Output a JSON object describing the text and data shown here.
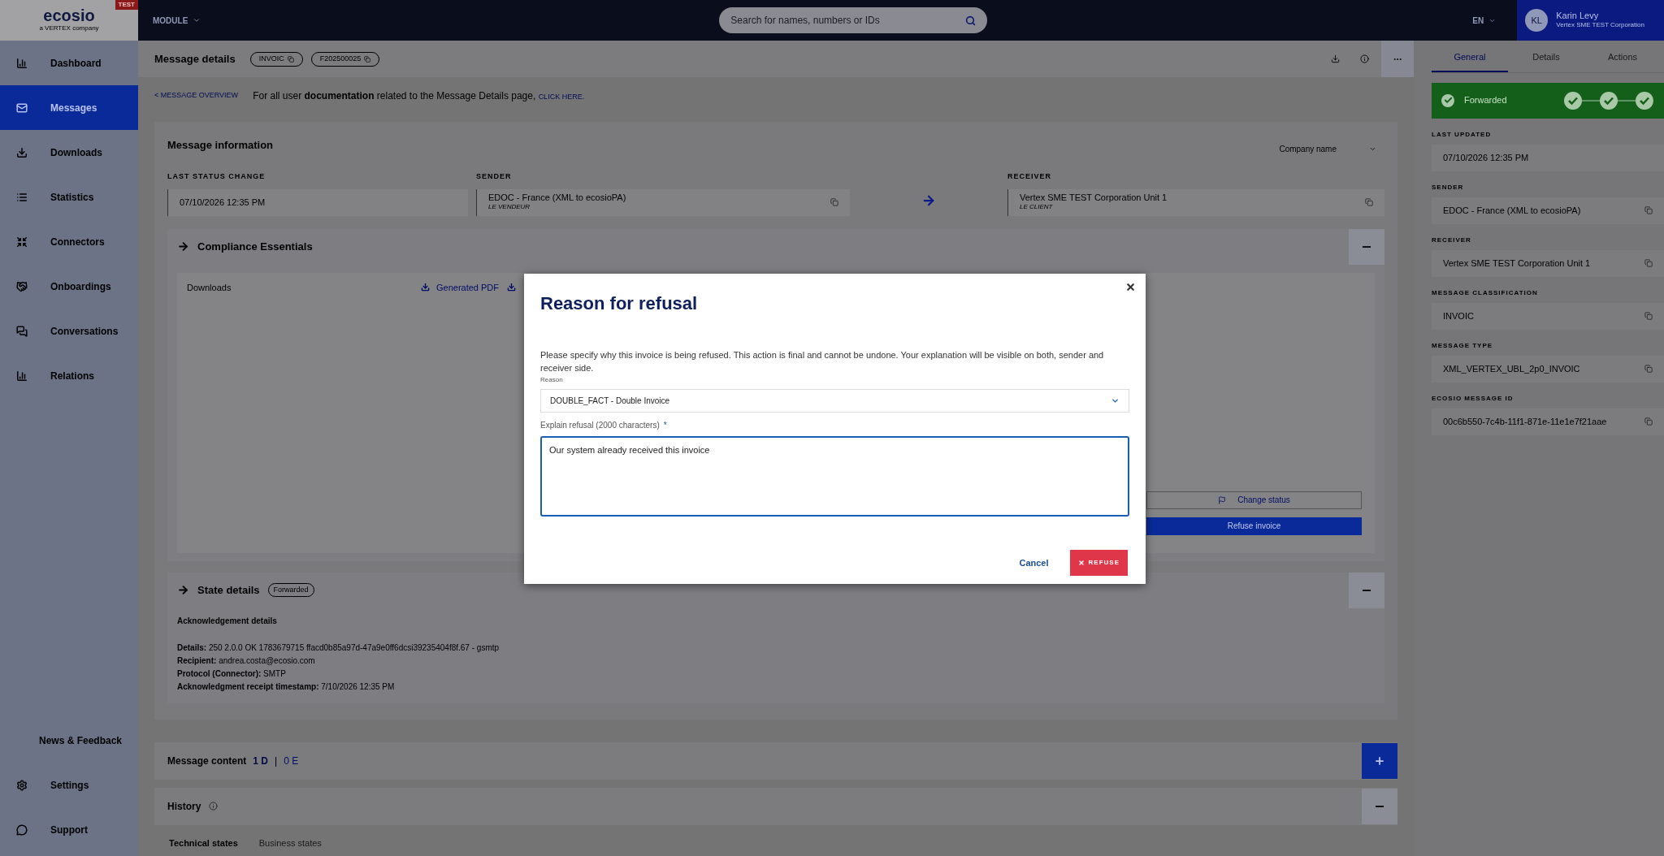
{
  "topbar": {
    "logo": "ecosio",
    "logo_tagline": "a VERTEX company",
    "env_badge": "TEST",
    "module_menu": "MODULE",
    "search": {
      "placeholder": "Search for names, numbers or IDs"
    },
    "language": "EN",
    "user": {
      "initials": "KL",
      "name": "Karin Levy",
      "company": "Vertex SME TEST Corporation"
    }
  },
  "sidebar": {
    "items": [
      {
        "label": "Dashboard",
        "selected": false
      },
      {
        "label": "Messages",
        "selected": true
      },
      {
        "label": "Downloads",
        "selected": false
      },
      {
        "label": "Statistics",
        "selected": false
      },
      {
        "label": "Connectors",
        "selected": false
      },
      {
        "label": "Onboardings",
        "selected": false
      },
      {
        "label": "Conversations",
        "selected": false
      },
      {
        "label": "Relations",
        "selected": false
      }
    ],
    "footer_items": [
      {
        "label": "News & Feedback",
        "selected": false
      },
      {
        "label": "Settings",
        "selected": false
      },
      {
        "label": "Support",
        "selected": false
      }
    ]
  },
  "page_header": {
    "title": "Message details",
    "chips": [
      "INVOIC",
      "F202500025"
    ]
  },
  "doc_note": {
    "back_link": "< MESSAGE OVERVIEW",
    "text": "For all user **documentation** related to the Message Details page,",
    "link": "CLICK HERE."
  },
  "message_information": {
    "title": "Message information",
    "company_select": "Company name",
    "fields": [
      {
        "label": "LAST STATUS CHANGE",
        "value": "07/10/2026 12:35 PM"
      },
      {
        "label": "SENDER",
        "value": "EDOC - France (XML to ecosioPA)",
        "role": "LE VENDEUR"
      },
      {
        "label": "RECEIVER",
        "value": "Vertex SME TEST Corporation Unit 1",
        "role": "LE CLIENT"
      }
    ]
  },
  "compliance": {
    "title": "Compliance Essentials",
    "expanded": true,
    "downloads_label": "Downloads",
    "download_links": [
      "Generated PDF"
    ],
    "actions": [
      "Change status",
      "Refuse invoice"
    ]
  },
  "state_details": {
    "title": "State details",
    "status_badge": "Forwarded",
    "expanded": true,
    "heading": "Acknowledgement details",
    "lines": [
      {
        "label": "Details:",
        "value": "250 2.0.0 OK 1783679715 ffacd0b85a97d-47a9e0ff6dcsi39235404f8f.67 - gsmtp"
      },
      {
        "label": "Recipient:",
        "value": "andrea.costa@ecosio.com"
      },
      {
        "label": "Protocol (Connector):",
        "value": "SMTP"
      },
      {
        "label": "Acknowledgment receipt timestamp:",
        "value": "7/10/2026 12:35 PM"
      }
    ]
  },
  "message_content": {
    "title": "Message content",
    "documents": "1 D",
    "separator": "|",
    "errors": "0 E",
    "expanded": false
  },
  "history": {
    "title": "History",
    "expanded": true,
    "tabs": [
      {
        "label": "Technical states",
        "selected": true
      },
      {
        "label": "Business states",
        "selected": false
      }
    ]
  },
  "side_panel": {
    "tabs": [
      {
        "label": "General",
        "selected": true
      },
      {
        "label": "Details",
        "selected": false
      },
      {
        "label": "Actions",
        "selected": false
      }
    ],
    "status": "Forwarded",
    "fields": [
      {
        "label": "LAST UPDATED",
        "value": "07/10/2026 12:35 PM",
        "copyable": false
      },
      {
        "label": "SENDER",
        "value": "EDOC - France (XML to ecosioPA)",
        "copyable": true
      },
      {
        "label": "RECEIVER",
        "value": "Vertex SME TEST Corporation Unit 1",
        "copyable": true
      },
      {
        "label": "MESSAGE CLASSIFICATION",
        "value": "INVOIC",
        "copyable": true
      },
      {
        "label": "MESSAGE TYPE",
        "value": "XML_VERTEX_UBL_2p0_INVOIC",
        "copyable": true
      },
      {
        "label": "ECOSIO MESSAGE ID",
        "value": "00c6b550-7c4b-11f1-871e-11e1e7f21aae",
        "copyable": true
      }
    ]
  },
  "modal": {
    "title": "Reason for refusal",
    "description": "Please specify why this invoice is being refused. This action is final and cannot be undone. Your explanation will be visible on both, sender and receiver side.",
    "reason": {
      "label": "Reason",
      "value": "DOUBLE_FACT - Double Invoice"
    },
    "explanation": {
      "label": "Explain refusal (2000 characters)",
      "required_mark": "*",
      "value": "Our system already received this invoice"
    },
    "buttons": [
      {
        "label": "Cancel",
        "kind": "text"
      },
      {
        "label": "REFUSE",
        "kind": "danger"
      }
    ]
  }
}
